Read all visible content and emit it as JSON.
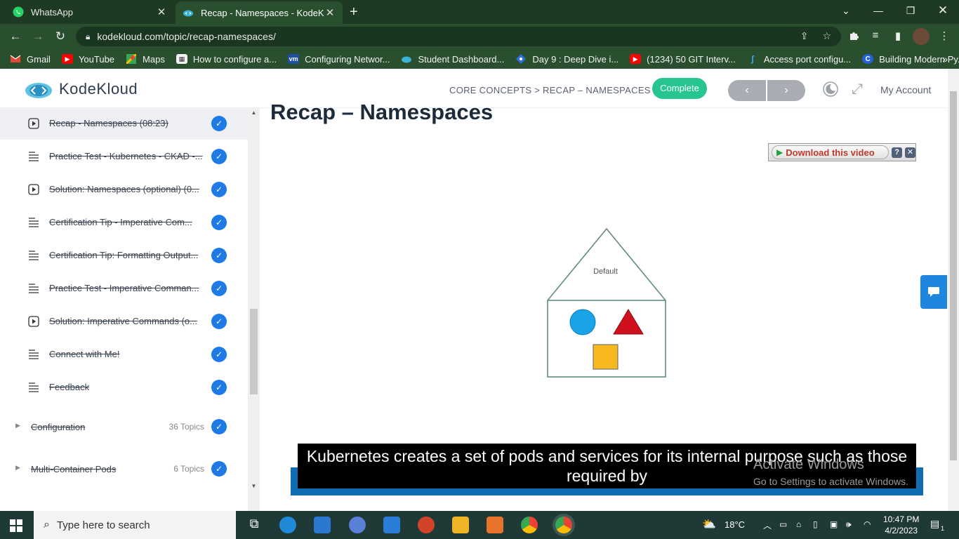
{
  "browser": {
    "tabs": [
      {
        "label": "WhatsApp",
        "icon": "whatsapp-icon",
        "active": false
      },
      {
        "label": "Recap - Namespaces - KodeKlou",
        "icon": "kodekloud-icon",
        "active": true
      }
    ],
    "url": "kodekloud.com/topic/recap-namespaces/",
    "bookmarks": [
      {
        "label": "Gmail",
        "icon": "gmail-icon"
      },
      {
        "label": "YouTube",
        "icon": "youtube-icon"
      },
      {
        "label": "Maps",
        "icon": "maps-icon"
      },
      {
        "label": "How to configure a...",
        "icon": "bookmark-icon"
      },
      {
        "label": "Configuring Networ...",
        "icon": "vmware-icon"
      },
      {
        "label": "Student Dashboard...",
        "icon": "kodekloud-icon"
      },
      {
        "label": "Day 9 : Deep Dive i...",
        "icon": "diamond-icon"
      },
      {
        "label": "(1234) 50 GIT Interv...",
        "icon": "youtube-icon"
      },
      {
        "label": "Access port configu...",
        "icon": "bookmark-icon"
      },
      {
        "label": "Building Modern Py...",
        "icon": "c-icon"
      }
    ]
  },
  "header": {
    "brand": "KodeKloud",
    "breadcrumb": "CORE CONCEPTS > RECAP – NAMESPACES",
    "complete_label": "Complete",
    "prev_label": "‹",
    "next_label": "›",
    "account_label": "My Account"
  },
  "sidebar": {
    "lessons": [
      {
        "label": "Recap - Namespaces (08:23)",
        "type": "video",
        "current": true
      },
      {
        "label": "Practice Test - Kubernetes - CKAD -...",
        "type": "text",
        "current": false
      },
      {
        "label": "Solution: Namespaces (optional) (0...",
        "type": "video",
        "current": false
      },
      {
        "label": "Certification Tip - Imperative Com...",
        "type": "text",
        "current": false
      },
      {
        "label": "Certification Tip: Formatting Output...",
        "type": "text",
        "current": false
      },
      {
        "label": "Practice Test - Imperative Comman...",
        "type": "text",
        "current": false
      },
      {
        "label": "Solution: Imperative Commands (o...",
        "type": "video",
        "current": false
      },
      {
        "label": "Connect with Me!",
        "type": "text",
        "current": false
      },
      {
        "label": "Feedback",
        "type": "text",
        "current": false
      }
    ],
    "sections": [
      {
        "title": "Configuration",
        "count": "36 Topics"
      },
      {
        "title": "Multi-Container Pods",
        "count": "6 Topics"
      }
    ]
  },
  "main": {
    "title": "Recap – Namespaces",
    "download_label": "Download this video",
    "diagram_label": "Default",
    "caption_line1": "Kubernetes creates a set of pods and services for its internal purpose such as those",
    "caption_line2": "required by",
    "watermark_line1": "Activate Windows",
    "watermark_line2": "Go to Settings to activate Windows."
  },
  "taskbar": {
    "search_placeholder": "Type here to search",
    "weather": "18°C",
    "time": "10:47 PM",
    "date": "4/2/2023",
    "notification_count": "1"
  }
}
